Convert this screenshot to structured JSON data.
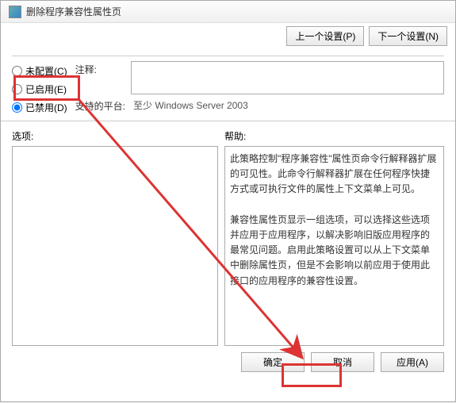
{
  "window": {
    "title": "删除程序兼容性属性页"
  },
  "topbar": {
    "prev_label": "上一个设置(P)",
    "next_label": "下一个设置(N)"
  },
  "radios": {
    "not_configured": "未配置(C)",
    "enabled": "已启用(E)",
    "disabled": "已禁用(D)"
  },
  "form": {
    "notes_label": "注释:",
    "platform_label": "支持的平台:",
    "platform_value": "至少 Windows Server 2003"
  },
  "sections": {
    "options_label": "选项:",
    "help_label": "帮助:"
  },
  "help_text": {
    "p1": "此策略控制\"程序兼容性\"属性页命令行解释器扩展的可见性。此命令行解释器扩展在任何程序快捷方式或可执行文件的属性上下文菜单上可见。",
    "p2": "兼容性属性页显示一组选项，可以选择这些选项并应用于应用程序，以解决影响旧版应用程序的最常见问题。启用此策略设置可以从上下文菜单中删除属性页，但是不会影响以前应用于使用此接口的应用程序的兼容性设置。"
  },
  "buttons": {
    "ok": "确定",
    "cancel": "取消",
    "apply": "应用(A)"
  }
}
